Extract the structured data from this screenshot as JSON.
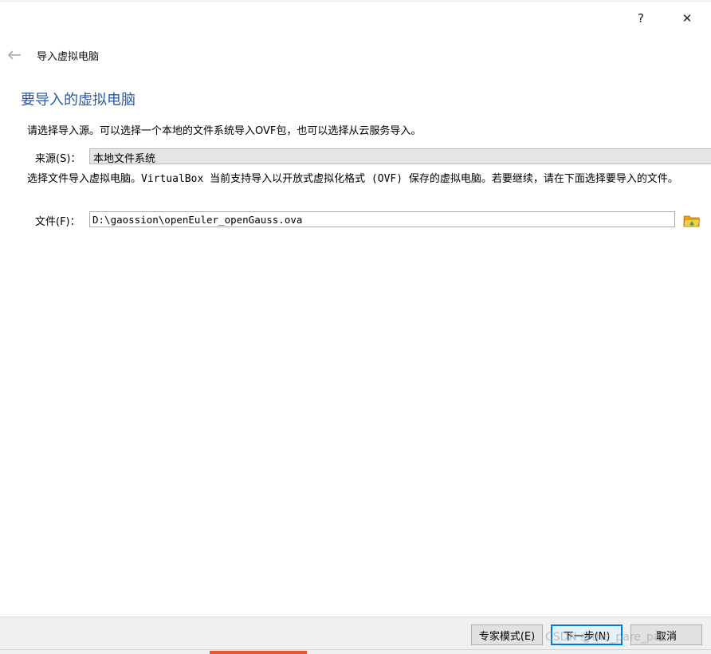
{
  "titlebar": {
    "help_label": "?",
    "close_label": "✕"
  },
  "wizard": {
    "title": "导入虚拟电脑",
    "page_heading": "要导入的虚拟电脑",
    "description": "请选择导入源。可以选择一个本地的文件系统导入OVF包，也可以选择从云服务导入。",
    "source": {
      "label": "来源(S)：",
      "value": "本地文件系统"
    },
    "file_description": "选择文件导入虚拟电脑。VirtualBox 当前支持导入以开放式虚拟化格式 (OVF) 保存的虚拟电脑。若要继续，请在下面选择要导入的文件。",
    "file": {
      "label": "文件(F)：",
      "value": "D:\\gaossion\\openEuler_openGauss.ova"
    }
  },
  "footer": {
    "expert_label": "专家模式(E)",
    "next_label": "下一步(N)",
    "cancel_label": "取消"
  },
  "watermark": "CSDN @the_pare_pas",
  "colors": {
    "heading": "#2a5aa0",
    "focus_border": "#0078d7",
    "folder_icon": "#f2b01e"
  },
  "icons": {
    "back": "back-arrow-icon",
    "folder": "folder-open-icon"
  }
}
